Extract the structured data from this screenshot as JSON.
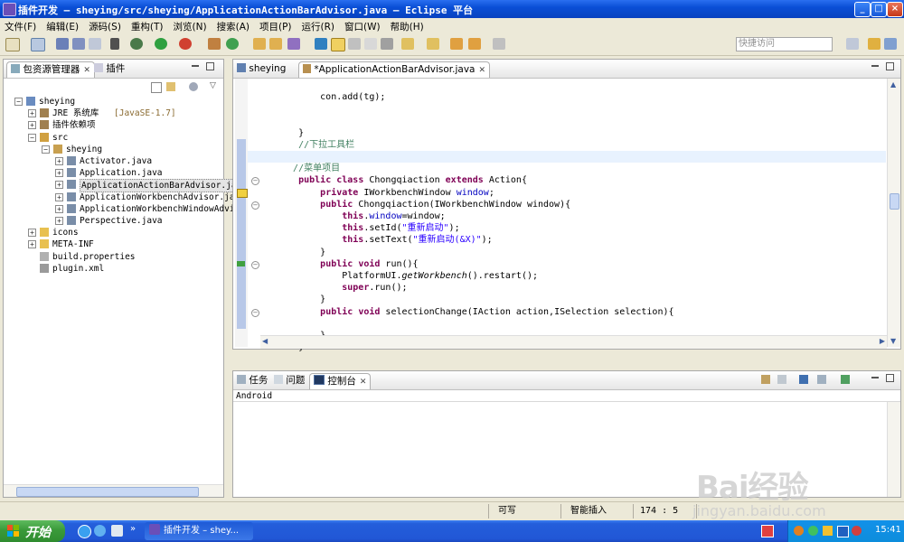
{
  "window": {
    "title": "插件开发 – sheying/src/sheying/ApplicationActionBarAdvisor.java – Eclipse 平台",
    "controls": [
      "_",
      "□",
      "×"
    ]
  },
  "menu": [
    "文件(F)",
    "编辑(E)",
    "源码(S)",
    "重构(T)",
    "浏览(N)",
    "搜索(A)",
    "项目(P)",
    "运行(R)",
    "窗口(W)",
    "帮助(H)"
  ],
  "toolbar": {
    "quick_access_placeholder": "快捷访问"
  },
  "package_explorer": {
    "tabs": [
      "包资源管理器",
      "插件"
    ],
    "tree": [
      {
        "label": "sheying",
        "depth": 0,
        "expanded": true,
        "icon": "project-icon"
      },
      {
        "label": "JRE 系统库",
        "suffix": " [JavaSE-1.7]",
        "depth": 1,
        "expanded": false,
        "icon": "library-icon"
      },
      {
        "label": "插件依赖项",
        "depth": 1,
        "expanded": false,
        "icon": "library-icon"
      },
      {
        "label": "src",
        "depth": 1,
        "expanded": true,
        "icon": "source-folder-icon"
      },
      {
        "label": "sheying",
        "depth": 2,
        "expanded": true,
        "icon": "package-icon"
      },
      {
        "label": "Activator.java",
        "depth": 3,
        "expanded": false,
        "icon": "java-file-icon"
      },
      {
        "label": "Application.java",
        "depth": 3,
        "expanded": false,
        "icon": "java-file-icon"
      },
      {
        "label": "ApplicationActionBarAdvisor.java",
        "depth": 3,
        "expanded": false,
        "icon": "java-file-icon",
        "selected": true
      },
      {
        "label": "ApplicationWorkbenchAdvisor.java",
        "depth": 3,
        "expanded": false,
        "icon": "java-file-icon"
      },
      {
        "label": "ApplicationWorkbenchWindowAdvisor",
        "depth": 3,
        "expanded": false,
        "icon": "java-file-icon"
      },
      {
        "label": "Perspective.java",
        "depth": 3,
        "expanded": false,
        "icon": "java-file-icon"
      },
      {
        "label": "icons",
        "depth": 1,
        "expanded": false,
        "icon": "folder-icon"
      },
      {
        "label": "META-INF",
        "depth": 1,
        "expanded": false,
        "icon": "folder-icon"
      },
      {
        "label": "build.properties",
        "depth": 1,
        "leaf": true,
        "icon": "properties-file-icon"
      },
      {
        "label": "plugin.xml",
        "depth": 1,
        "leaf": true,
        "icon": "xml-file-icon"
      }
    ]
  },
  "editor": {
    "tabs": [
      "sheying",
      "*ApplicationActionBarAdvisor.java"
    ],
    "lines": [
      [
        {
          "t": "        con.add(tg);",
          "c": ""
        }
      ],
      [
        {
          "t": "",
          "c": ""
        }
      ],
      [
        {
          "t": "",
          "c": ""
        }
      ],
      [
        {
          "t": "    }",
          "c": ""
        }
      ],
      [
        {
          "t": "    //下拉工具栏",
          "c": "cmt"
        }
      ],
      [
        {
          "t": "",
          "c": ""
        }
      ],
      [
        {
          "t": "   //菜单项目",
          "c": "cmt"
        }
      ],
      [
        {
          "t": "    ",
          "c": ""
        },
        {
          "t": "public class",
          "c": "kw"
        },
        {
          "t": " Chongqiaction ",
          "c": ""
        },
        {
          "t": "extends",
          "c": "kw"
        },
        {
          "t": " Action{",
          "c": ""
        }
      ],
      [
        {
          "t": "        ",
          "c": ""
        },
        {
          "t": "private",
          "c": "kw"
        },
        {
          "t": " IWorkbenchWindow ",
          "c": ""
        },
        {
          "t": "window",
          "c": "fld"
        },
        {
          "t": ";",
          "c": ""
        }
      ],
      [
        {
          "t": "        ",
          "c": ""
        },
        {
          "t": "public",
          "c": "kw"
        },
        {
          "t": " Chongqiaction(IWorkbenchWindow window){",
          "c": ""
        }
      ],
      [
        {
          "t": "            ",
          "c": ""
        },
        {
          "t": "this",
          "c": "kw"
        },
        {
          "t": ".",
          "c": ""
        },
        {
          "t": "window",
          "c": "fld"
        },
        {
          "t": "=window;",
          "c": ""
        }
      ],
      [
        {
          "t": "            ",
          "c": ""
        },
        {
          "t": "this",
          "c": "kw"
        },
        {
          "t": ".setId(",
          "c": ""
        },
        {
          "t": "\"重新启动\"",
          "c": "str"
        },
        {
          "t": ");",
          "c": ""
        }
      ],
      [
        {
          "t": "            ",
          "c": ""
        },
        {
          "t": "this",
          "c": "kw"
        },
        {
          "t": ".setText(",
          "c": ""
        },
        {
          "t": "\"重新启动(&X)\"",
          "c": "str"
        },
        {
          "t": ");",
          "c": ""
        }
      ],
      [
        {
          "t": "        }",
          "c": ""
        }
      ],
      [
        {
          "t": "        ",
          "c": ""
        },
        {
          "t": "public void",
          "c": "kw"
        },
        {
          "t": " run(){",
          "c": ""
        }
      ],
      [
        {
          "t": "            PlatformUI.",
          "c": ""
        },
        {
          "t": "getWorkbench",
          "c": "ital"
        },
        {
          "t": "().restart();",
          "c": ""
        }
      ],
      [
        {
          "t": "            ",
          "c": ""
        },
        {
          "t": "super",
          "c": "kw"
        },
        {
          "t": ".run();",
          "c": ""
        }
      ],
      [
        {
          "t": "        }",
          "c": ""
        }
      ],
      [
        {
          "t": "        ",
          "c": ""
        },
        {
          "t": "public void",
          "c": "kw"
        },
        {
          "t": " selectionChange(IAction action,ISelection selection){",
          "c": ""
        }
      ],
      [
        {
          "t": "",
          "c": ""
        }
      ],
      [
        {
          "t": "        }",
          "c": ""
        }
      ],
      [
        {
          "t": "    }",
          "c": ""
        }
      ]
    ]
  },
  "console": {
    "tabs": [
      "任务",
      "问题",
      "控制台"
    ],
    "output": "Android"
  },
  "status": {
    "writable": "可写",
    "insert_mode": "智能插入",
    "position": "174 : 5"
  },
  "taskbar": {
    "start": "开始",
    "task": "插件开发 – shey...",
    "clock": "15:41"
  },
  "watermark": {
    "brand": "Bai经验",
    "url": "jingyan.baidu.com"
  }
}
